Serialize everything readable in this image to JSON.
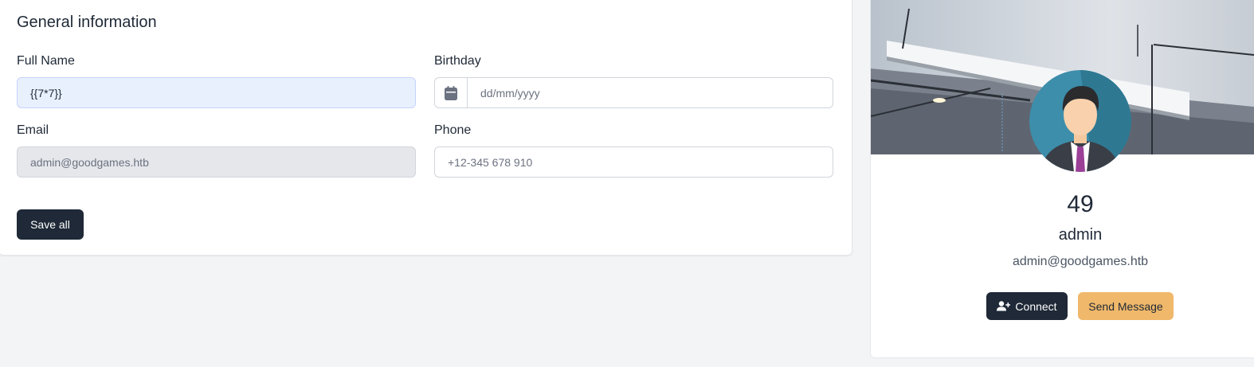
{
  "general": {
    "title": "General information",
    "full_name_label": "Full Name",
    "full_name_value": "{{7*7}}",
    "birthday_label": "Birthday",
    "birthday_placeholder": "dd/mm/yyyy",
    "email_label": "Email",
    "email_value": "admin@goodgames.htb",
    "phone_label": "Phone",
    "phone_placeholder": "+12-345 678 910",
    "save_label": "Save all"
  },
  "profile": {
    "rendered_name": "49",
    "username": "admin",
    "email": "admin@goodgames.htb",
    "connect_label": "Connect",
    "message_label": "Send Message"
  },
  "colors": {
    "dark_button": "#1f2937",
    "gold_button": "#f0b86a",
    "focused_input": "#e8f0fe",
    "disabled_input": "#e5e7eb"
  }
}
